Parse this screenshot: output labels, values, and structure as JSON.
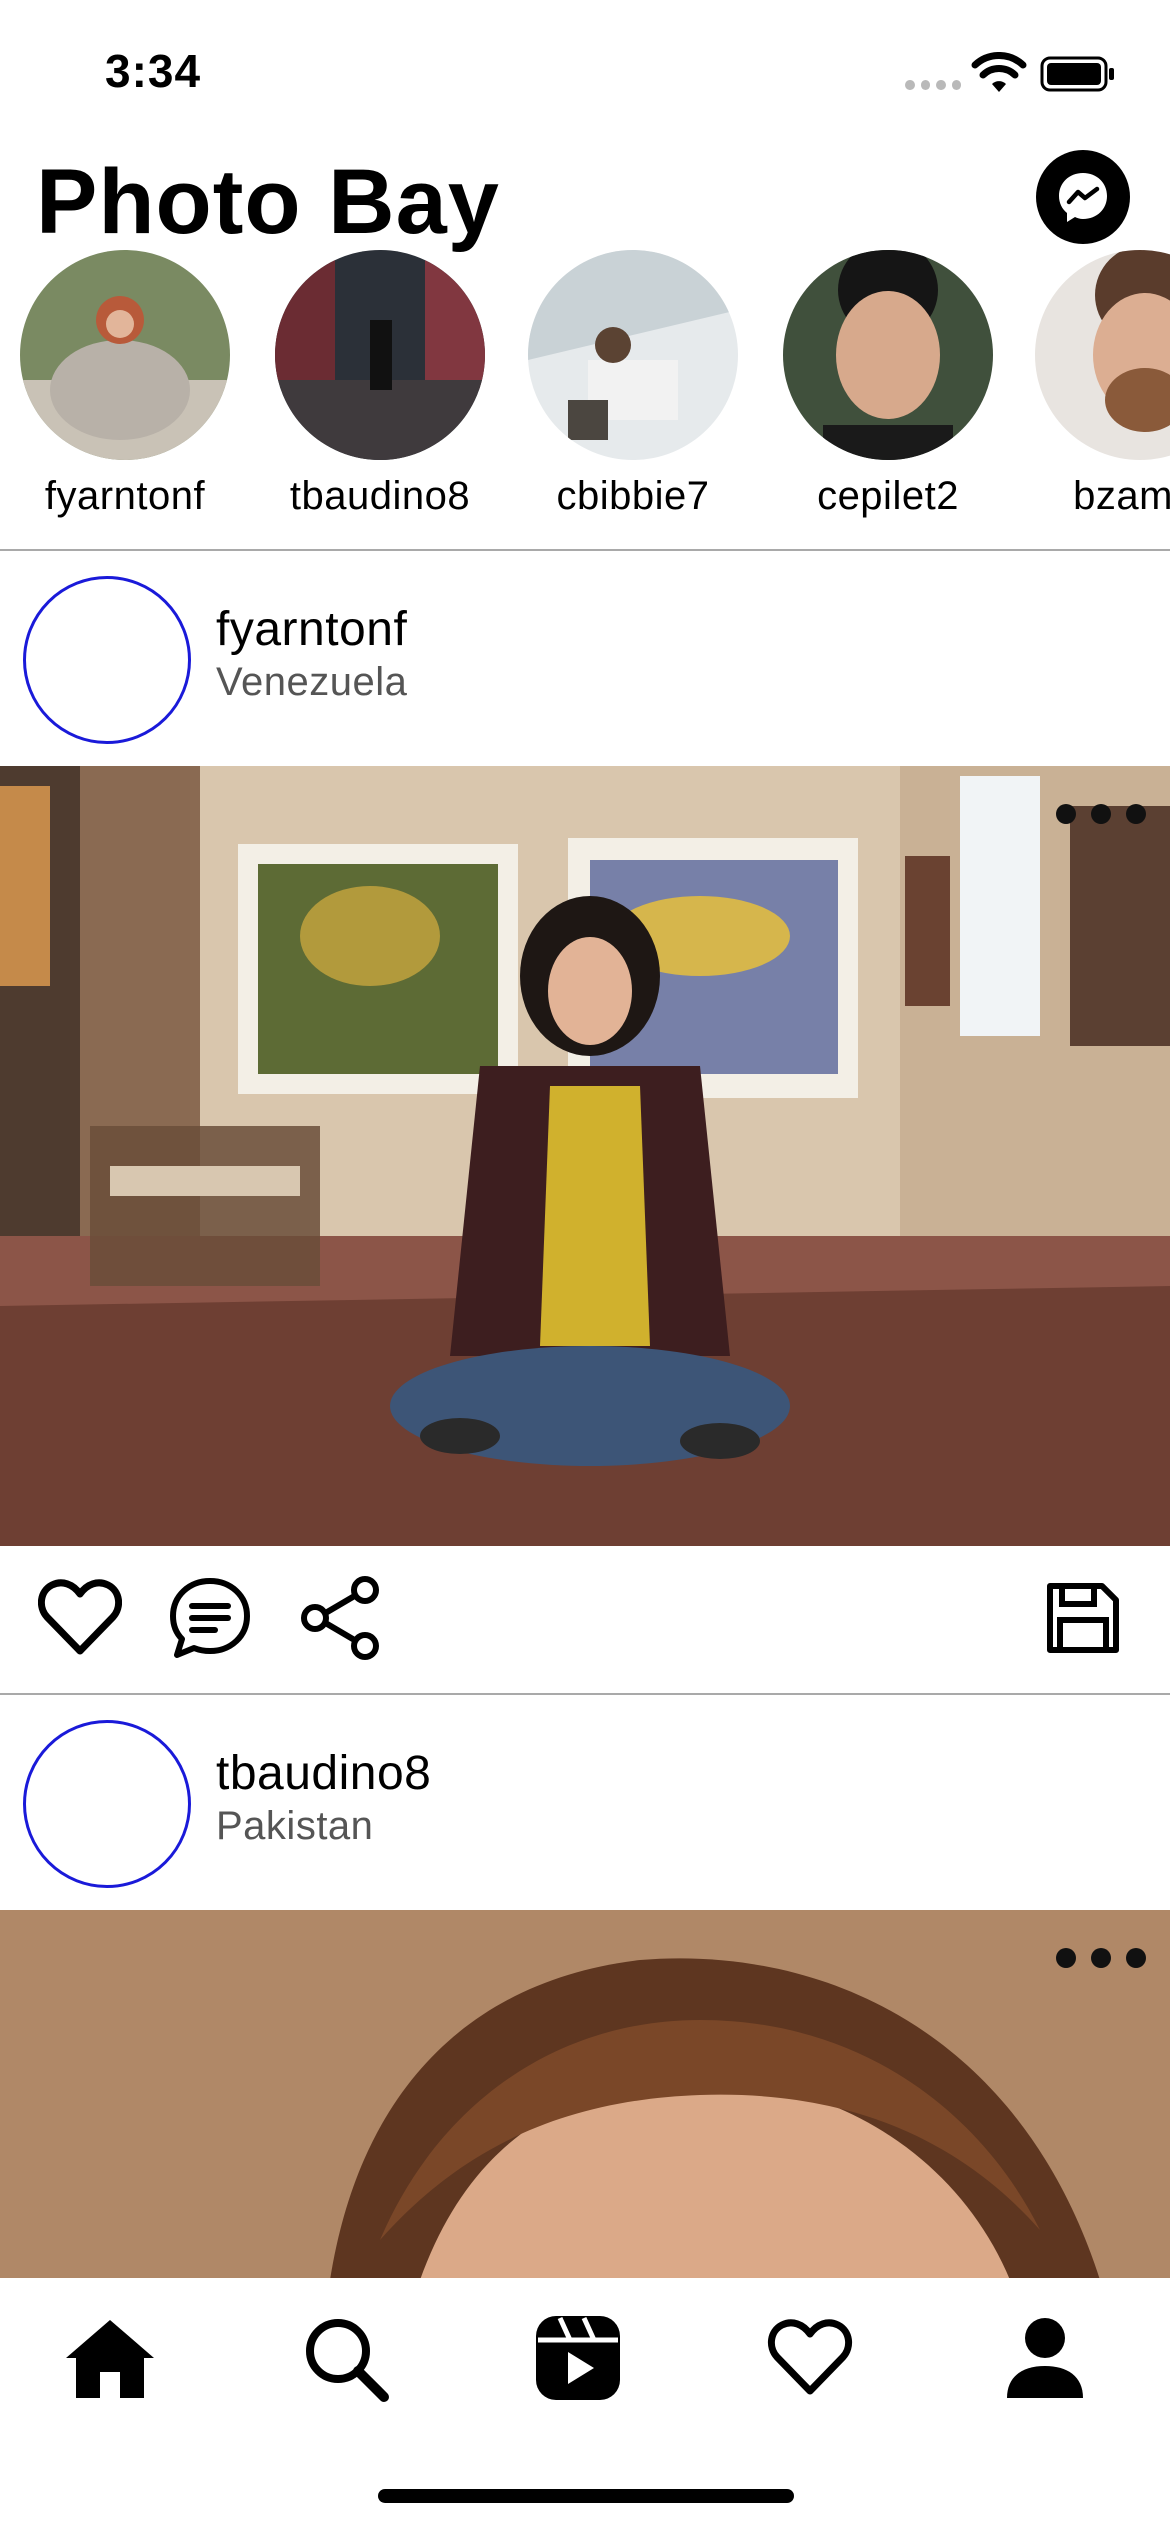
{
  "status_bar": {
    "time": "3:34"
  },
  "header": {
    "title": "Photo Bay",
    "messenger_icon": "messenger-icon"
  },
  "stories": [
    {
      "username": "fyarntonf"
    },
    {
      "username": "tbaudino8"
    },
    {
      "username": "cbibbie7"
    },
    {
      "username": "cepilet2"
    },
    {
      "username": "bzamm"
    }
  ],
  "posts": [
    {
      "username": "fyarntonf",
      "location": "Venezuela"
    },
    {
      "username": "tbaudino8",
      "location": "Pakistan"
    }
  ],
  "post_actions": {
    "like_icon": "heart-icon",
    "comment_icon": "comment-icon",
    "share_icon": "share-icon",
    "save_icon": "save-icon"
  },
  "tab_bar": [
    "home-icon",
    "search-icon",
    "reels-icon",
    "heart-icon",
    "profile-icon"
  ],
  "colors": {
    "avatar_ring": "#1a1ad9",
    "divider": "#a9a9a9",
    "text": "#000000",
    "muted": "#555555"
  }
}
